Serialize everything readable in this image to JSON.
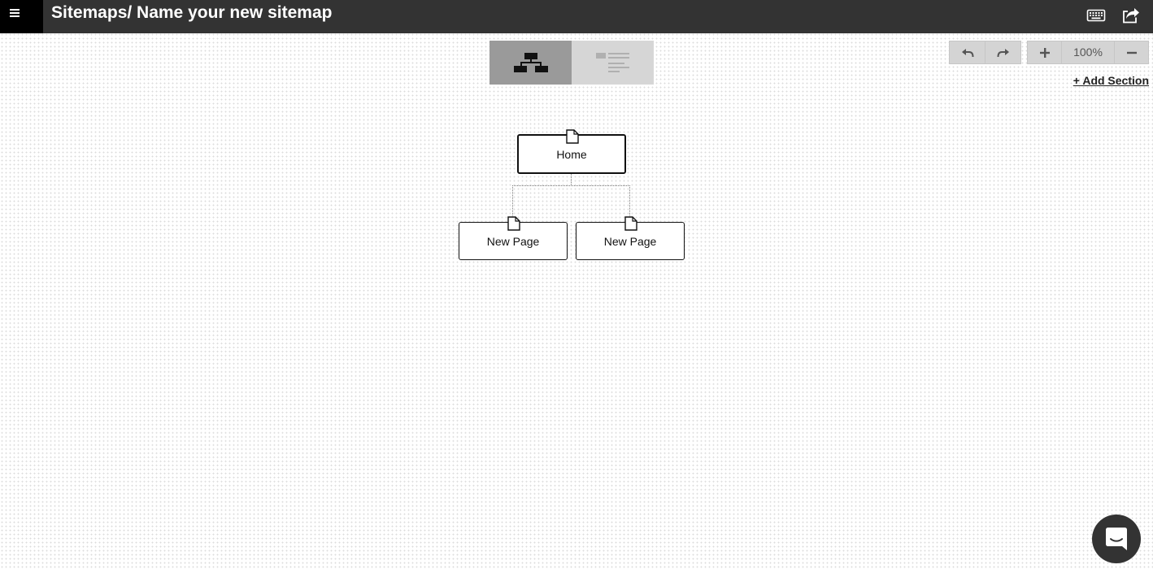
{
  "header": {
    "breadcrumb": "Sitemaps/ Name your new sitemap",
    "menu_icon": "hamburger-menu-icon",
    "keyboard_icon": "keyboard-icon",
    "share_icon": "share-icon",
    "background": "#333333"
  },
  "view_toggle": {
    "active": "tree",
    "tree_icon": "sitemap-tree-icon",
    "list_icon": "list-view-icon"
  },
  "toolbar": {
    "undo_icon": "undo-icon",
    "redo_icon": "redo-icon",
    "zoom_in_icon": "plus-icon",
    "zoom_level": "100%",
    "zoom_out_icon": "minus-icon",
    "add_section": "+ Add Section"
  },
  "sitemap": {
    "root": {
      "label": "Home",
      "icon": "page-icon"
    },
    "children": [
      {
        "label": "New Page",
        "icon": "page-icon"
      },
      {
        "label": "New Page",
        "icon": "page-icon"
      }
    ]
  },
  "chat": {
    "icon": "chat-icon"
  }
}
